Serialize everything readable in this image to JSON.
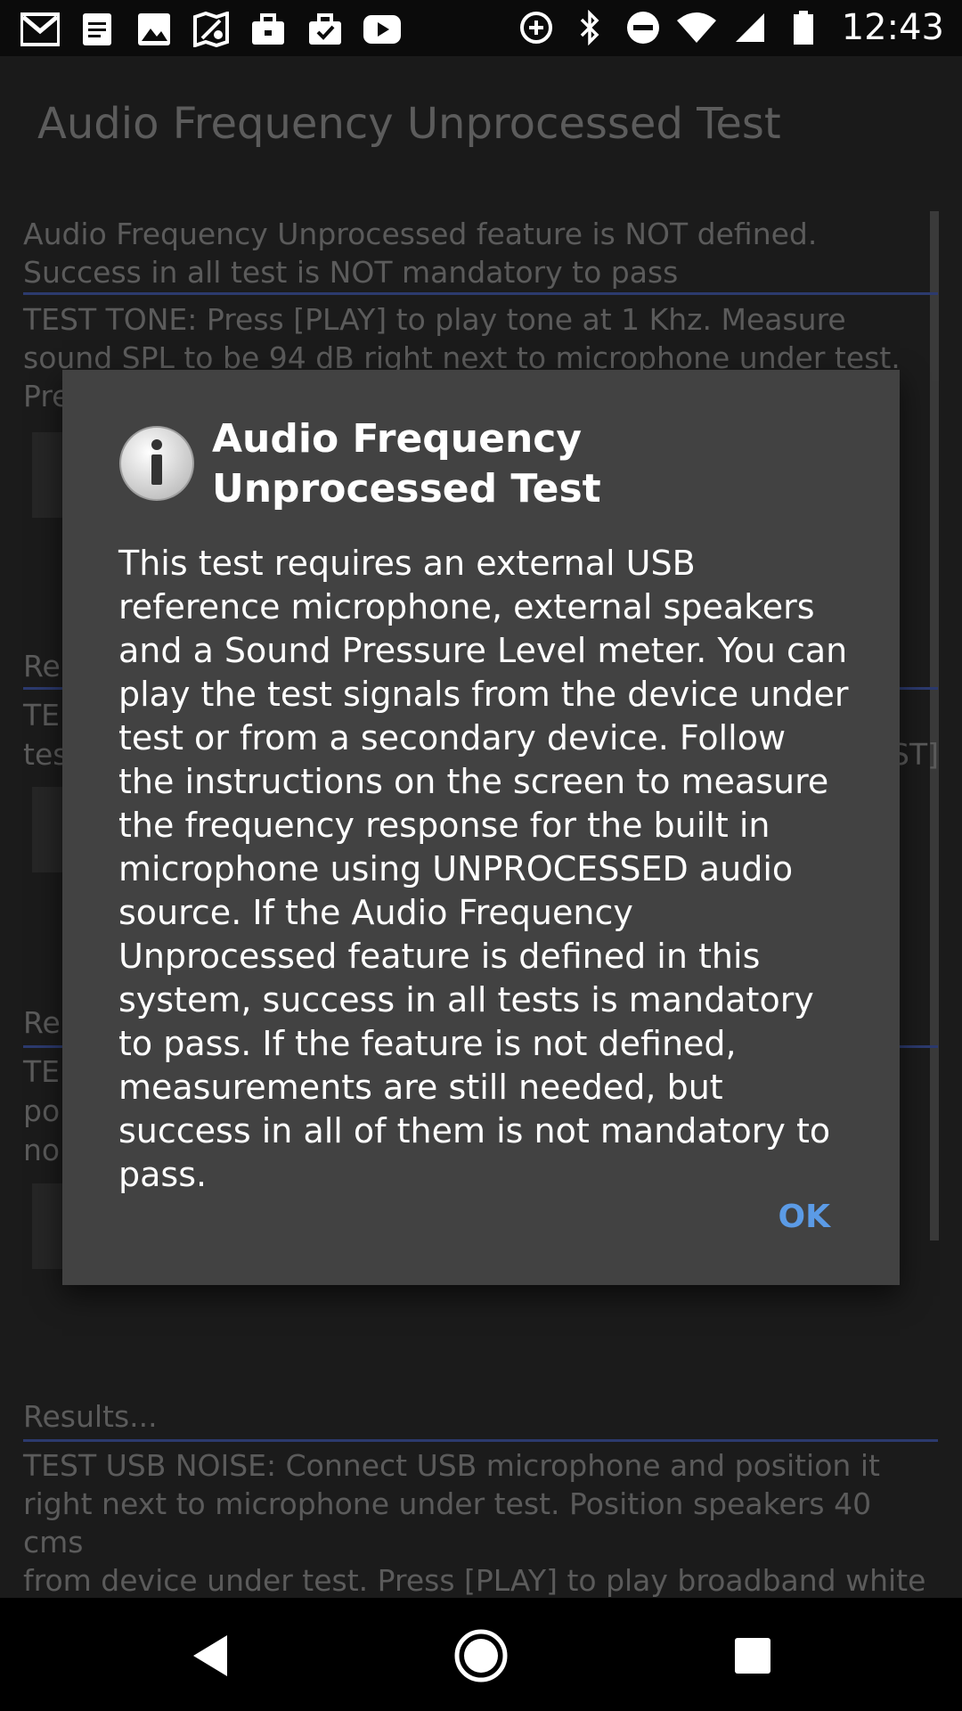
{
  "status_bar": {
    "time": "12:43",
    "left_icons": [
      "gmail-icon",
      "docs-icon",
      "photos-icon",
      "maps-icon",
      "briefcase-icon",
      "briefcase-check-icon",
      "youtube-icon"
    ],
    "right_icons": [
      "data-saver-icon",
      "bluetooth-icon",
      "do-not-disturb-icon",
      "wifi-icon",
      "signal-icon",
      "battery-icon"
    ]
  },
  "app_bar": {
    "title": "Audio Frequency Unprocessed Test"
  },
  "background": {
    "notice": "Audio Frequency Unprocessed feature is NOT defined.\nSuccess in all test is NOT mandatory to pass",
    "test_tone": "TEST TONE: Press [PLAY] to play tone at 1 Khz. Measure\nsound SPL to be 94 dB right next to microphone under test.\nPre",
    "results_frag_1": "Re",
    "test_frag_1a": "TE",
    "test_frag_1b": "tes",
    "test_frag_1c": "ST]",
    "results_frag_2": "Re",
    "test_frag_2a": "TE",
    "test_frag_2b": "po",
    "test_frag_2c": "no",
    "results_label": "Results...",
    "usb_noise": "TEST USB NOISE: Connect USB microphone and position it\nright next to microphone under test. Position speakers 40 cms\nfrom device under test. Press [PLAY] to play broadband white\nnoise. Press [TEST]..."
  },
  "dialog": {
    "icon": "info-icon",
    "title": "Audio Frequency Unprocessed Test",
    "body": "This test requires an external USB reference microphone, external speakers and a Sound Pressure Level meter. You can play the test signals from the device under test or from a secondary device. Follow the instructions on the screen to measure the frequency response for the built in microphone using UNPROCESSED audio source. If the Audio Frequency Unprocessed feature is defined in this system, success in all tests is mandatory to pass. If the feature is not defined, measurements are still needed, but success in all of them is not mandatory to pass.",
    "ok_label": "OK"
  },
  "nav_bar": {
    "buttons": [
      "back-icon",
      "home-icon",
      "recents-icon"
    ]
  },
  "colors": {
    "accent": "#5b9be6",
    "dialog_bg": "#424242",
    "divider": "#2c3a6e"
  }
}
